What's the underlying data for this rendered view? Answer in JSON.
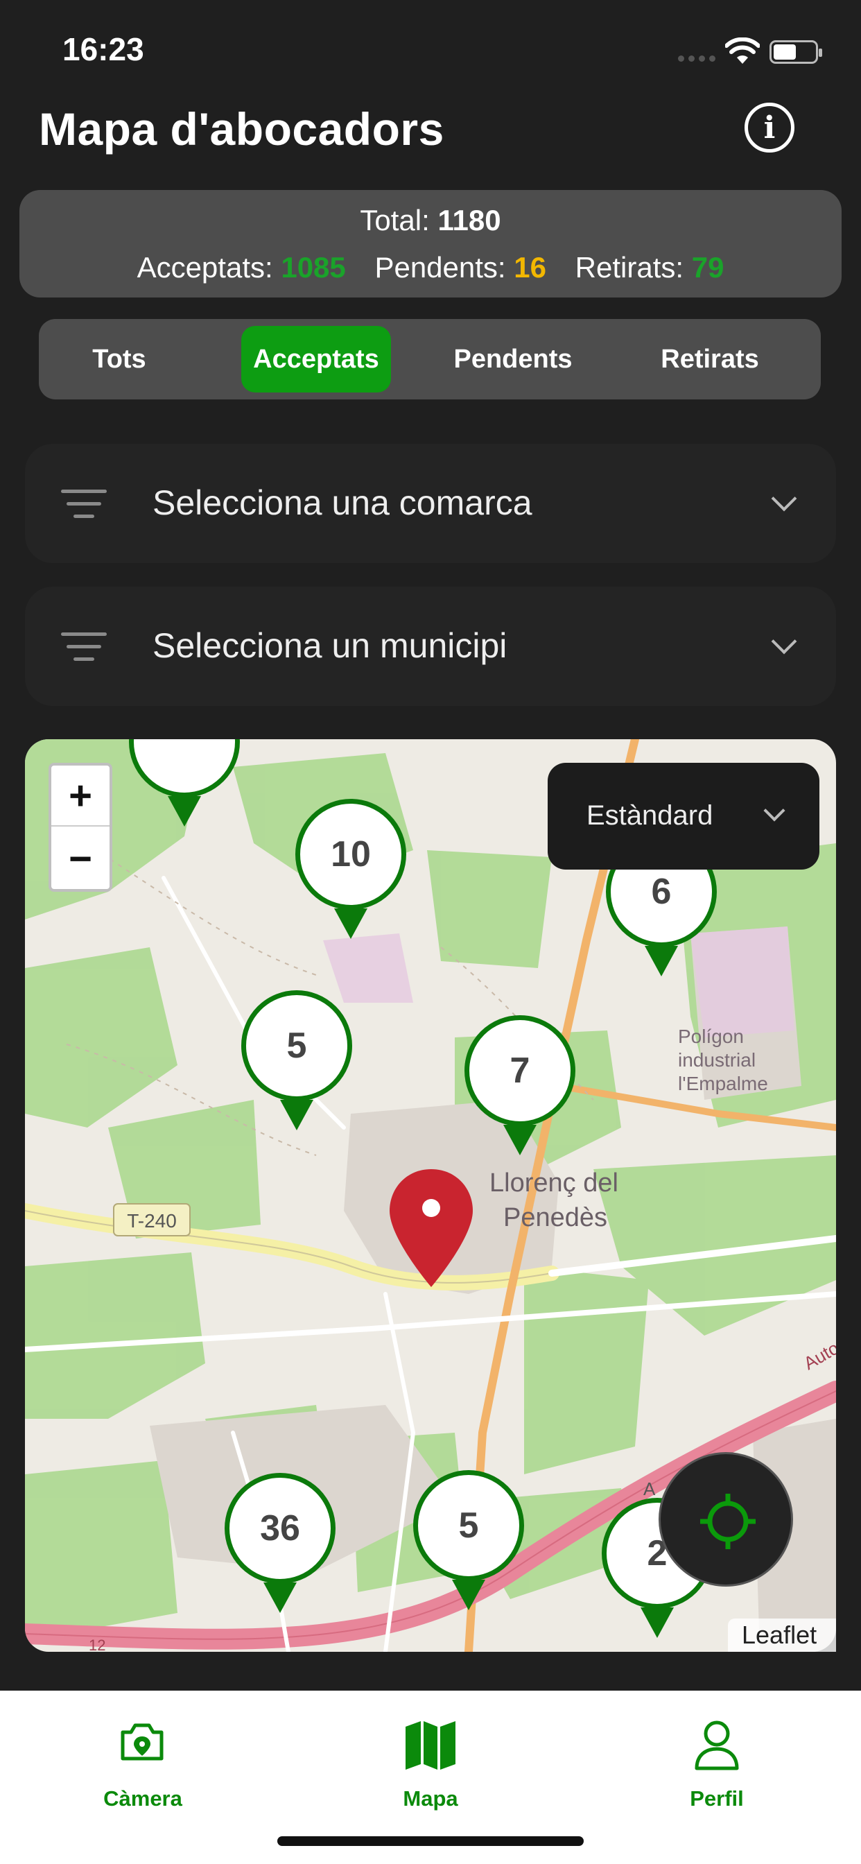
{
  "status": {
    "time": "16:23"
  },
  "header": {
    "title": "Mapa d'abocadors",
    "info_icon": "info-icon"
  },
  "stats": {
    "total_label": "Total:",
    "total": "1180",
    "accepted_label": "Acceptats:",
    "accepted": "1085",
    "pending_label": "Pendents:",
    "pending": "16",
    "removed_label": "Retirats:",
    "removed": "79",
    "colors": {
      "accepted": "#1aa32a",
      "pending": "#f2b700",
      "removed": "#1aa32a"
    }
  },
  "tabs": [
    {
      "label": "Tots",
      "active": false
    },
    {
      "label": "Acceptats",
      "active": true
    },
    {
      "label": "Pendents",
      "active": false
    },
    {
      "label": "Retirats",
      "active": false
    }
  ],
  "filters": {
    "comarca_placeholder": "Selecciona una comarca",
    "municipi_placeholder": "Selecciona un municipi"
  },
  "map": {
    "layer_selected": "Estàndard",
    "zoom_in": "+",
    "zoom_out": "−",
    "attribution": "Leaflet",
    "road_label": "T-240",
    "place_label_1": "Llorenç del",
    "place_label_2": "Penedès",
    "industrial_1": "Polígon",
    "industrial_2": "industrial",
    "industrial_3": "l'Empalme",
    "highway_label": "Auto",
    "road_label_2": "A",
    "road_label_3": "12",
    "clusters": [
      {
        "count": "",
        "id": "top-left"
      },
      {
        "count": "10"
      },
      {
        "count": "6"
      },
      {
        "count": "5"
      },
      {
        "count": "7"
      },
      {
        "count": "36"
      },
      {
        "count": "5"
      },
      {
        "count": "2"
      }
    ],
    "accent": "#0b7a0b"
  },
  "bottom_nav": [
    {
      "label": "Càmera",
      "icon": "camera-location-icon"
    },
    {
      "label": "Mapa",
      "icon": "map-icon"
    },
    {
      "label": "Perfil",
      "icon": "user-icon"
    }
  ]
}
